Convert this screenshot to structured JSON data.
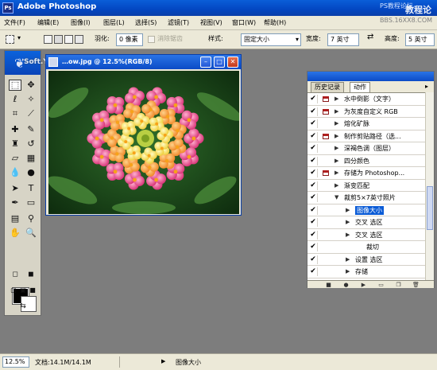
{
  "app": {
    "title": "Adobe Photoshop",
    "icon_text": "Ps"
  },
  "watermark": {
    "top_right_small": "PS教程论坛",
    "top_right_large": "教程论坛",
    "menu_right": "BBS.16XX8.COM",
    "left_text": "Soft.Yesky.com"
  },
  "menu": [
    "文件(F)",
    "编辑(E)",
    "图像(I)",
    "图层(L)",
    "选择(S)",
    "滤镜(T)",
    "视图(V)",
    "窗口(W)",
    "帮助(H)"
  ],
  "options": {
    "feather_label": "羽化:",
    "feather_value": "0 像素",
    "antialias_label": "消除锯齿",
    "style_label": "样式:",
    "style_value": "固定大小",
    "width_label": "宽度:",
    "width_value": "7 英寸",
    "height_label": "高度:",
    "height_value": "5 英寸"
  },
  "document": {
    "title": "Soft.Yesky.com 12.5%(RGB/8)",
    "title_short": "…ow.jpg @ 12.5%(RGB/8)"
  },
  "panel": {
    "tabs": [
      "历史记录",
      "动作"
    ],
    "active_tab": "动作",
    "actions": [
      {
        "label": "水中倒影（文字）",
        "checked": true,
        "dialog": true,
        "expanded": false,
        "indent": 0,
        "highlight": false
      },
      {
        "label": "为灰度自定义 RGB",
        "checked": true,
        "dialog": true,
        "expanded": false,
        "indent": 0,
        "highlight": false
      },
      {
        "label": "熔化矿脉",
        "checked": true,
        "dialog": false,
        "expanded": false,
        "indent": 0,
        "highlight": false
      },
      {
        "label": "制作剪贴路径（选...",
        "checked": true,
        "dialog": true,
        "expanded": false,
        "indent": 0,
        "highlight": false
      },
      {
        "label": "深褐色调（图层）",
        "checked": true,
        "dialog": false,
        "expanded": false,
        "indent": 0,
        "highlight": false
      },
      {
        "label": "四分颜色",
        "checked": true,
        "dialog": false,
        "expanded": false,
        "indent": 0,
        "highlight": false
      },
      {
        "label": "存储为 Photoshop...",
        "checked": true,
        "dialog": true,
        "expanded": false,
        "indent": 0,
        "highlight": false
      },
      {
        "label": "渐变匹配",
        "checked": true,
        "dialog": false,
        "expanded": false,
        "indent": 0,
        "highlight": false
      },
      {
        "label": "裁剪5×7英寸照片",
        "checked": true,
        "dialog": false,
        "expanded": true,
        "indent": 0,
        "highlight": false
      },
      {
        "label": "图像大小",
        "checked": true,
        "dialog": false,
        "expanded": false,
        "indent": 1,
        "highlight": true
      },
      {
        "label": "交叉 选区",
        "checked": true,
        "dialog": false,
        "expanded": false,
        "indent": 1,
        "highlight": false
      },
      {
        "label": "交叉 选区",
        "checked": true,
        "dialog": false,
        "expanded": false,
        "indent": 1,
        "highlight": false
      },
      {
        "label": "裁切",
        "checked": true,
        "dialog": false,
        "expanded": false,
        "indent": 2,
        "highlight": false
      },
      {
        "label": "设置 选区",
        "checked": true,
        "dialog": false,
        "expanded": false,
        "indent": 1,
        "highlight": false
      },
      {
        "label": "存储",
        "checked": true,
        "dialog": false,
        "expanded": false,
        "indent": 1,
        "highlight": false
      },
      {
        "label": "关闭",
        "checked": true,
        "dialog": false,
        "expanded": false,
        "indent": 2,
        "highlight": false
      }
    ]
  },
  "status": {
    "zoom": "12.5%",
    "doc": "文档:14.1M/14.1M",
    "message": "图像大小"
  },
  "colors": {
    "foreground": "#000000",
    "background": "#ffffff",
    "highlight": "#0a5bd6"
  }
}
